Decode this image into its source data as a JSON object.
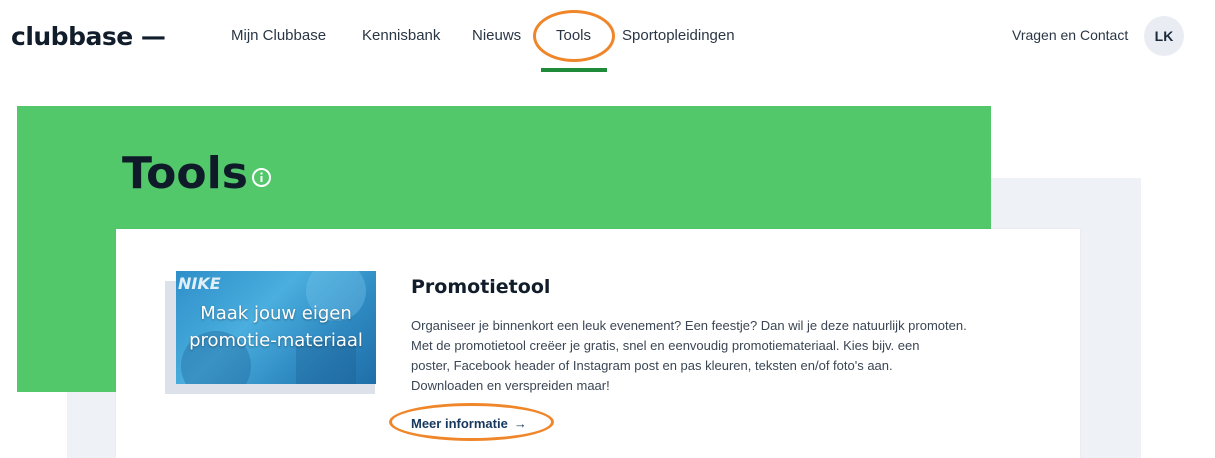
{
  "header": {
    "logo": "clubbase —",
    "nav": [
      {
        "label": "Mijn Clubbase"
      },
      {
        "label": "Kennisbank"
      },
      {
        "label": "Nieuws"
      },
      {
        "label": "Tools",
        "active": true
      },
      {
        "label": "Sportopleidingen"
      }
    ],
    "contact_label": "Vragen en Contact",
    "avatar_initials": "LK"
  },
  "page": {
    "title": "Tools",
    "info_icon": "info-circle-icon"
  },
  "card": {
    "image_brand": "NIKE",
    "image_text_line1": "Maak jouw eigen",
    "image_text_line2": "promotie-materiaal",
    "title": "Promotietool",
    "description_lines": [
      "Organiseer je binnenkort een leuk evenement? Een feestje? Dan wil je deze natuurlijk promoten.",
      "Met de promotietool creëer je gratis, snel en eenvoudig promotiemateriaal. Kies bijv. een",
      "poster, Facebook header of Instagram post en pas kleuren, teksten en/of foto's aan.",
      "Downloaden en verspreiden maar!"
    ],
    "link_label": "Meer informatie",
    "link_arrow": "→"
  },
  "colors": {
    "brand_green": "#52c86b",
    "nav_underline": "#1f8a3a",
    "annotation_orange": "#f0862a",
    "text_dark": "#111d2b",
    "link_blue": "#16385f"
  }
}
